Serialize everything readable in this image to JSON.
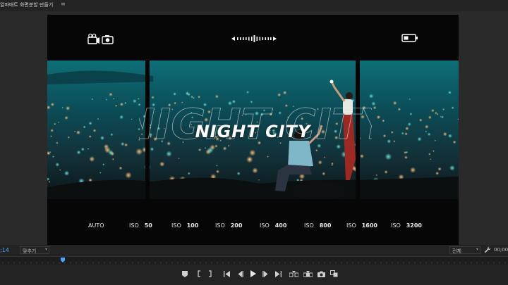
{
  "panel": {
    "title": "알파매트 화면분할 만들기",
    "menu_glyph": "≡"
  },
  "program": {
    "title_text": "NIGHT CITY",
    "iso_items": [
      {
        "label": "AUTO",
        "value": ""
      },
      {
        "label": "ISO",
        "value": "50"
      },
      {
        "label": "ISO",
        "value": "100"
      },
      {
        "label": "ISO",
        "value": "200"
      },
      {
        "label": "ISO",
        "value": "400"
      },
      {
        "label": "ISO",
        "value": "800"
      },
      {
        "label": "ISO",
        "value": "1600"
      },
      {
        "label": "ISO",
        "value": "3200"
      }
    ]
  },
  "status": {
    "timecode": ";14",
    "fit_label": "맞추기",
    "resolution_label": "전체",
    "end_timecode": "00;00"
  },
  "icons": {
    "record": "video-camera-icon",
    "photo": "photo-camera-icon",
    "zoom": "zoom-dial-icon",
    "battery": "battery-icon",
    "wrench": "wrench-icon"
  },
  "colors": {
    "accent": "#4aa3ff",
    "panel_bg": "#232323",
    "viewer_bg": "#2a2a2a"
  }
}
